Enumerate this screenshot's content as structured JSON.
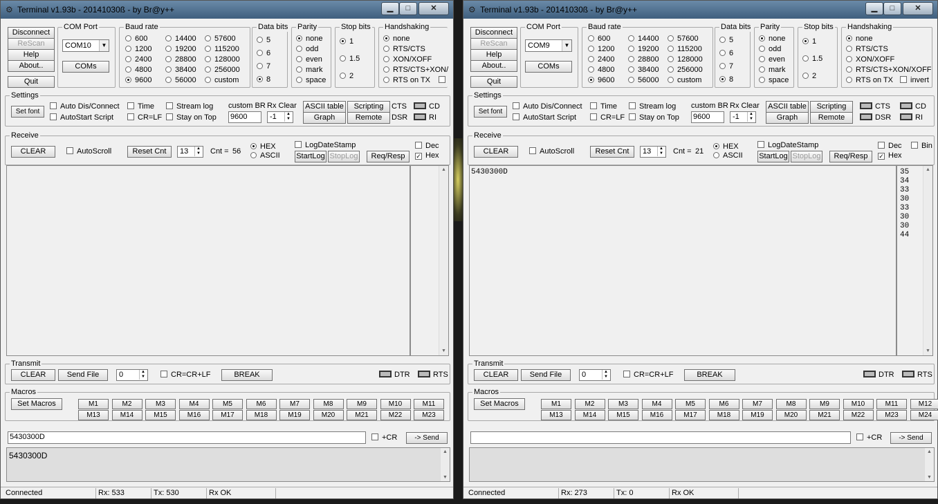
{
  "windows": [
    {
      "title": "Terminal v1.93b - 20141030ß - by Br@y++",
      "buttons": {
        "disconnect": "Disconnect",
        "rescan": "ReScan",
        "help": "Help",
        "about": "About..",
        "quit": "Quit"
      },
      "com": {
        "label": "COM Port",
        "selected": "COM10",
        "coms": "COMs"
      },
      "baud": {
        "label": "Baud rate",
        "options": [
          "600",
          "1200",
          "2400",
          "4800",
          "9600",
          "14400",
          "19200",
          "28800",
          "38400",
          "56000",
          "57600",
          "115200",
          "128000",
          "256000",
          "custom"
        ],
        "selected": "9600"
      },
      "databits": {
        "label": "Data bits",
        "options": [
          "5",
          "6",
          "7",
          "8"
        ],
        "selected": "8"
      },
      "parity": {
        "label": "Parity",
        "options": [
          "none",
          "odd",
          "even",
          "mark",
          "space"
        ],
        "selected": "none"
      },
      "stopbits": {
        "label": "Stop bits",
        "options": [
          "1",
          "1.5",
          "2"
        ],
        "selected": "1"
      },
      "handshaking": {
        "label": "Handshaking",
        "options": [
          "none",
          "RTS/CTS",
          "XON/XOFF",
          "RTS/CTS+XON/",
          "RTS on TX"
        ],
        "selected": "none"
      },
      "settings": {
        "label": "Settings",
        "set_font": "Set font",
        "auto_dis": "Auto Dis/Connect",
        "autostart": "AutoStart Script",
        "time": "Time",
        "crlf": "CR=LF",
        "stream_log": "Stream log",
        "stay_on_top": "Stay on Top",
        "custom_br_label": "custom BR",
        "custom_br": "9600",
        "rx_clear_label": "Rx Clear",
        "rx_clear": "-1",
        "ascii_table": "ASCII table",
        "scripting": "Scripting",
        "graph": "Graph",
        "remote": "Remote",
        "cts": "CTS",
        "dsr": "DSR",
        "cd": "CD",
        "ri": "RI"
      },
      "receive": {
        "label": "Receive",
        "clear": "CLEAR",
        "autoscroll": "AutoScroll",
        "reset_cnt": "Reset Cnt",
        "cnt_spin": "13",
        "cnt_label": "Cnt =",
        "cnt_value": "56",
        "hex": "HEX",
        "ascii": "ASCII",
        "logdatestamp": "LogDateStamp",
        "startlog": "StartLog",
        "stoplog": "StopLog",
        "req_resp": "Req/Resp",
        "dec": "Dec",
        "hexcb": "Hex",
        "text": "",
        "hex_lines": []
      },
      "transmit": {
        "label": "Transmit",
        "clear": "CLEAR",
        "send_file": "Send File",
        "spin": "0",
        "cr_crlf": "CR=CR+LF",
        "break": "BREAK",
        "dtr": "DTR",
        "rts": "RTS"
      },
      "macros": {
        "label": "Macros",
        "set_macros": "Set Macros",
        "row1": [
          "M1",
          "M2",
          "M3",
          "M4",
          "M5",
          "M6",
          "M7",
          "M8",
          "M9",
          "M10",
          "M11"
        ],
        "row2": [
          "M13",
          "M14",
          "M15",
          "M16",
          "M17",
          "M18",
          "M19",
          "M20",
          "M21",
          "M22",
          "M23"
        ]
      },
      "send": {
        "input": "5430300D",
        "plus_cr": "+CR",
        "send": "-> Send"
      },
      "sent_log": "5430300D",
      "status": {
        "state": "Connected",
        "rx": "Rx: 533",
        "tx": "Tx: 530",
        "rxok": "Rx OK"
      }
    },
    {
      "title": "Terminal v1.93b - 20141030ß - by Br@y++",
      "buttons": {
        "disconnect": "Disconnect",
        "rescan": "ReScan",
        "help": "Help",
        "about": "About..",
        "quit": "Quit"
      },
      "com": {
        "label": "COM Port",
        "selected": "COM9",
        "coms": "COMs"
      },
      "baud": {
        "label": "Baud rate",
        "options": [
          "600",
          "1200",
          "2400",
          "4800",
          "9600",
          "14400",
          "19200",
          "28800",
          "38400",
          "56000",
          "57600",
          "115200",
          "128000",
          "256000",
          "custom"
        ],
        "selected": "9600"
      },
      "databits": {
        "label": "Data bits",
        "options": [
          "5",
          "6",
          "7",
          "8"
        ],
        "selected": "8"
      },
      "parity": {
        "label": "Parity",
        "options": [
          "none",
          "odd",
          "even",
          "mark",
          "space"
        ],
        "selected": "none"
      },
      "stopbits": {
        "label": "Stop bits",
        "options": [
          "1",
          "1.5",
          "2"
        ],
        "selected": "1"
      },
      "handshaking": {
        "label": "Handshaking",
        "options": [
          "none",
          "RTS/CTS",
          "XON/XOFF",
          "RTS/CTS+XON/XOFF",
          "RTS on TX"
        ],
        "selected": "none",
        "invert": "invert"
      },
      "settings": {
        "label": "Settings",
        "set_font": "Set font",
        "auto_dis": "Auto Dis/Connect",
        "autostart": "AutoStart Script",
        "time": "Time",
        "crlf": "CR=LF",
        "stream_log": "Stream log",
        "stay_on_top": "Stay on Top",
        "custom_br_label": "custom BR",
        "custom_br": "9600",
        "rx_clear_label": "Rx Clear",
        "rx_clear": "-1",
        "ascii_table": "ASCII table",
        "scripting": "Scripting",
        "graph": "Graph",
        "remote": "Remote",
        "cts": "CTS",
        "dsr": "DSR",
        "cd": "CD",
        "ri": "RI"
      },
      "receive": {
        "label": "Receive",
        "clear": "CLEAR",
        "autoscroll": "AutoScroll",
        "reset_cnt": "Reset Cnt",
        "cnt_spin": "13",
        "cnt_label": "Cnt =",
        "cnt_value": "21",
        "hex": "HEX",
        "ascii": "ASCII",
        "logdatestamp": "LogDateStamp",
        "startlog": "StartLog",
        "stoplog": "StopLog",
        "req_resp": "Req/Resp",
        "dec": "Dec",
        "hexcb": "Hex",
        "bin": "Bin",
        "text": "5430300D",
        "hex_lines": [
          "35",
          "34",
          "33",
          "30",
          "33",
          "30",
          "30",
          "44"
        ]
      },
      "transmit": {
        "label": "Transmit",
        "clear": "CLEAR",
        "send_file": "Send File",
        "spin": "0",
        "cr_crlf": "CR=CR+LF",
        "break": "BREAK",
        "dtr": "DTR",
        "rts": "RTS"
      },
      "macros": {
        "label": "Macros",
        "set_macros": "Set Macros",
        "row1": [
          "M1",
          "M2",
          "M3",
          "M4",
          "M5",
          "M6",
          "M7",
          "M8",
          "M9",
          "M10",
          "M11",
          "M12"
        ],
        "row2": [
          "M13",
          "M14",
          "M15",
          "M16",
          "M17",
          "M18",
          "M19",
          "M20",
          "M21",
          "M22",
          "M23",
          "M24"
        ]
      },
      "send": {
        "input": "",
        "plus_cr": "+CR",
        "send": "-> Send"
      },
      "sent_log": "",
      "status": {
        "state": "Connected",
        "rx": "Rx: 273",
        "tx": "Tx: 0",
        "rxok": "Rx OK"
      }
    }
  ]
}
